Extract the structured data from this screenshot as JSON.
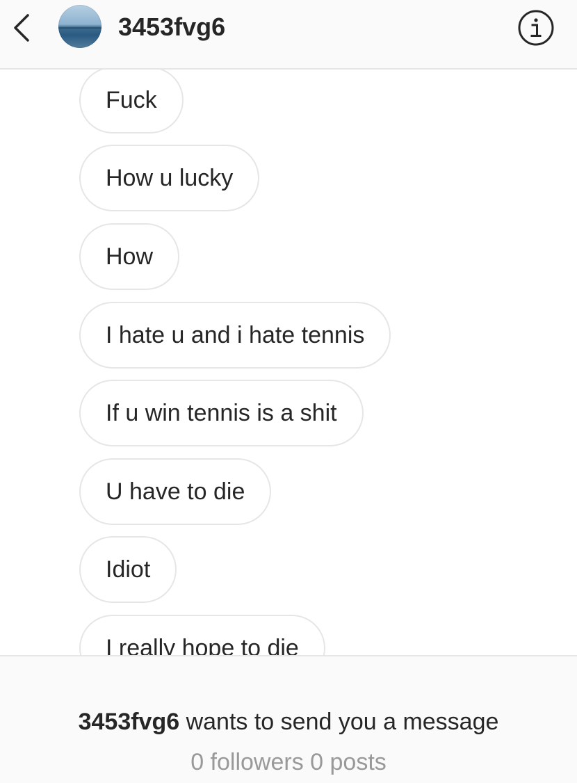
{
  "header": {
    "username": "3453fvg6",
    "back_icon": "chevron-left-icon",
    "info_icon": "info-circle-icon"
  },
  "messages": [
    {
      "text": "Fuck"
    },
    {
      "text": "How u lucky"
    },
    {
      "text": "How"
    },
    {
      "text": "I hate u and i hate tennis"
    },
    {
      "text": "If u win tennis is a shit"
    },
    {
      "text": "U have to die"
    },
    {
      "text": "Idiot"
    },
    {
      "text": "I really hope to die"
    }
  ],
  "footer": {
    "username": "3453fvg6",
    "request_text": " wants to send you a message",
    "followers_label": "0 followers",
    "posts_label": "0 posts"
  },
  "colors": {
    "text": "#262626",
    "secondary_text": "#999999",
    "border": "#e6e6e6",
    "bar_background": "#fafafa"
  }
}
